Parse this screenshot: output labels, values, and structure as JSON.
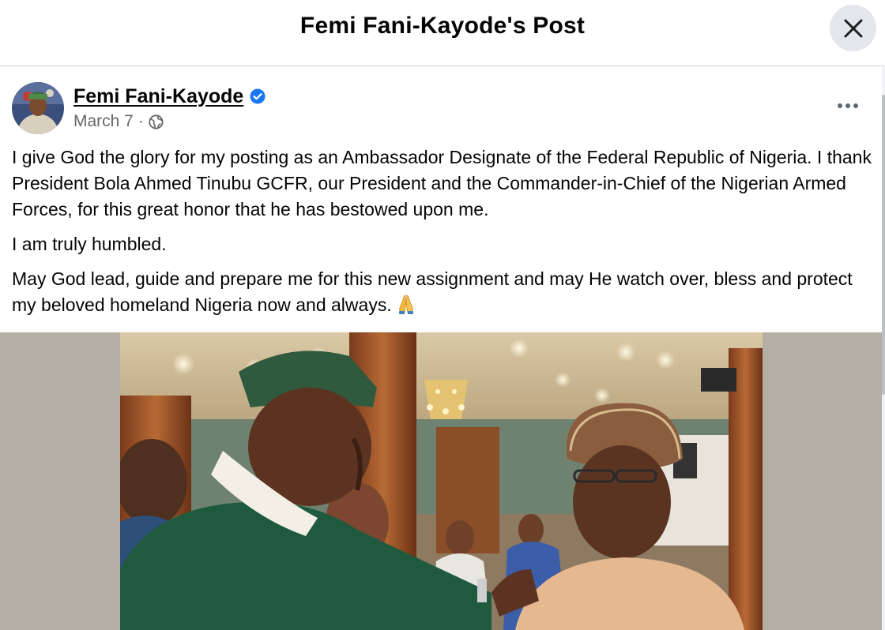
{
  "dialog": {
    "title": "Femi Fani-Kayode's Post"
  },
  "post": {
    "author": "Femi Fani-Kayode",
    "date": "March 7",
    "separator": "·",
    "audience_icon": "globe-icon",
    "verified_icon": "verified-badge-icon",
    "paragraphs": [
      "I give God the glory for my posting as an Ambassador Designate of the Federal Republic of Nigeria. I thank President Bola Ahmed Tinubu GCFR, our President and the Commander-in-Chief of the Nigerian Armed Forces, for this great honor that he has  bestowed upon me.",
      "I am truly humbled.",
      "May God lead, guide and prepare me for this new assignment and may He watch over, bless and protect my beloved homeland Nigeria now and always."
    ],
    "emoji": "🙏"
  },
  "colors": {
    "accent_blue": "#1877f2",
    "secondary_text": "#65676b",
    "close_bg": "#e4e6eb"
  }
}
